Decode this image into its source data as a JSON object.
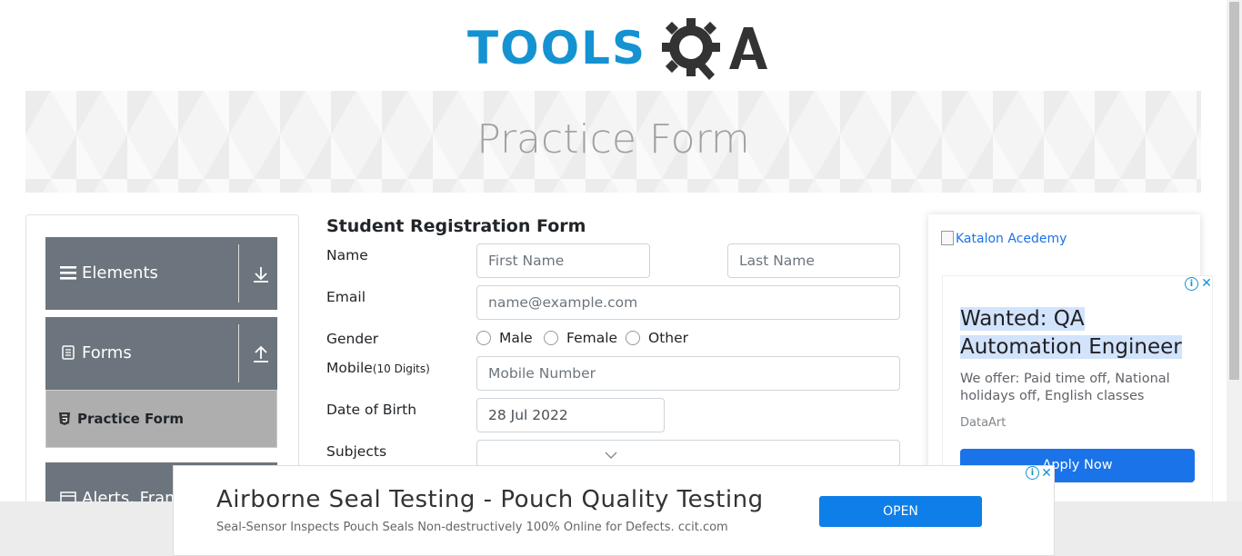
{
  "logo": {
    "text_tools": "TOOLS",
    "text_qa": "QA"
  },
  "banner": {
    "title": "Practice Form"
  },
  "sidebar": {
    "groups": [
      {
        "label": "Elements"
      },
      {
        "label": "Forms"
      },
      {
        "label": "Alerts, Frame & Windows"
      }
    ],
    "active_item": "Practice Form"
  },
  "form": {
    "title": "Student Registration Form",
    "name_label": "Name",
    "first_name_placeholder": "First Name",
    "last_name_placeholder": "Last Name",
    "email_label": "Email",
    "email_placeholder": "name@example.com",
    "gender_label": "Gender",
    "gender_options": [
      "Male",
      "Female",
      "Other"
    ],
    "mobile_label": "Mobile",
    "mobile_hint": "(10 Digits)",
    "mobile_placeholder": "Mobile Number",
    "dob_label": "Date of Birth",
    "dob_value": "28 Jul 2022",
    "subjects_label": "Subjects"
  },
  "right_ad": {
    "image_alt": "Katalon Acedemy",
    "headline": "Wanted: QA Automation Engineer",
    "body": "We offer: Paid time off, National holidays off, English classes",
    "source": "DataArt",
    "button": "Apply Now"
  },
  "bottom_ad": {
    "title": "Airborne Seal Testing - Pouch Quality Testing",
    "description": "Seal-Sensor Inspects Pouch Seals Non-destructively 100% Online for Defects. ccit.com",
    "button": "OPEN"
  },
  "colors": {
    "brand_blue": "#1592d1",
    "sidebar_gray": "#6c757d",
    "ad_blue": "#1a73e8"
  }
}
